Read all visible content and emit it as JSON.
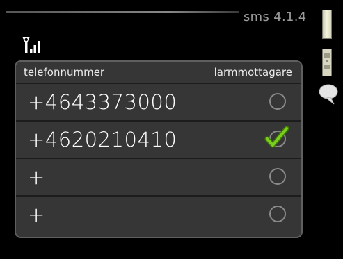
{
  "header": {
    "menu_code": "sms 4.1.4"
  },
  "status": {
    "signal_icon": "antenna-signal-icon"
  },
  "table": {
    "column_phone": "telefonnummer",
    "column_alarm": "larmmottagare",
    "rows": [
      {
        "number": "+4643373000",
        "alarm_receiver": false
      },
      {
        "number": "+4620210410",
        "alarm_receiver": true
      },
      {
        "number": "+",
        "alarm_receiver": false
      },
      {
        "number": "+",
        "alarm_receiver": false
      }
    ]
  },
  "colors": {
    "background": "#000000",
    "panel": "#363636",
    "check_green": "#6fbf16"
  },
  "side_icons": [
    "scrollbar-thumb",
    "settings-icon",
    "help-chat-icon"
  ]
}
